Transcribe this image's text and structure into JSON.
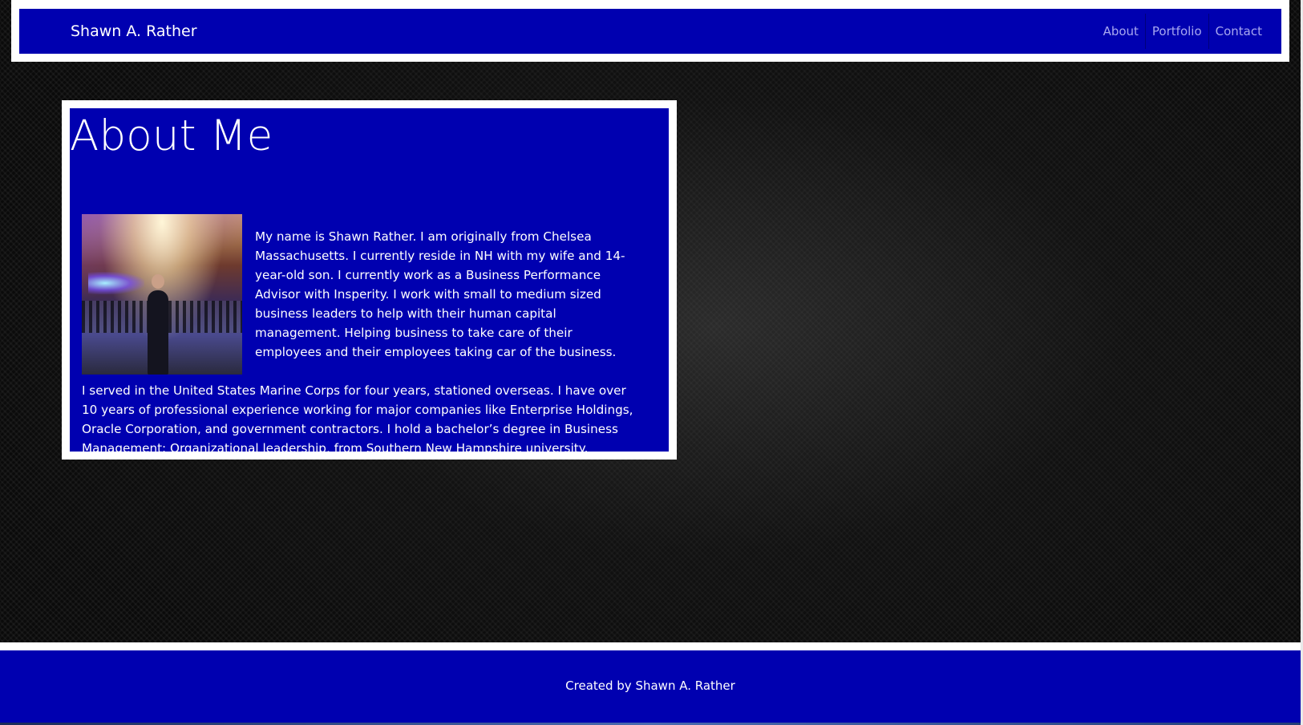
{
  "navbar": {
    "brand": "Shawn A. Rather",
    "links": [
      "About",
      "Portfolio",
      "Contact"
    ]
  },
  "about": {
    "title": "About Me",
    "photo_alt": "Shawn A. Rather at an event in a ballroom",
    "paragraph1": "My name is Shawn Rather. I am originally from Chelsea Massachusetts. I currently reside in NH with my wife and 14-year-old son. I currently work as a Business Performance Advisor with Insperity. I work with small to medium sized business leaders to help with their human capital management. Helping business to take care of their employees and their employees taking car of the business.",
    "paragraph2": "I served in the United States Marine Corps for four years, stationed overseas. I have over 10 years of professional experience working for major companies like Enterprise Holdings, Oracle Corporation, and government contractors. I hold a bachelor’s degree in Business Management: Organizational leadership, from Southern New Hampshire university."
  },
  "footer": {
    "text": "Created by Shawn A. Rather"
  },
  "colors": {
    "brand_blue": "#0000b0",
    "link_color": "#a8a8f0",
    "frame_white": "#ffffff"
  }
}
